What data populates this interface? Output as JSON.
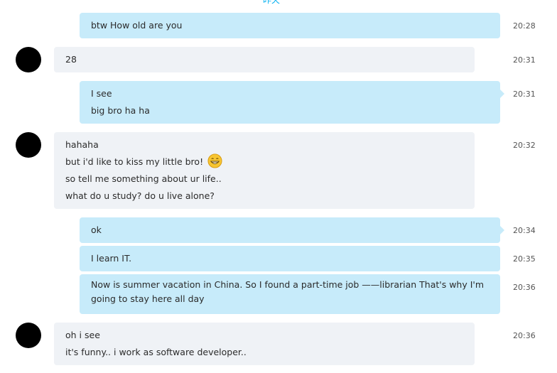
{
  "header_peek": "昨天",
  "messages": [
    {
      "text": "btw How old are you",
      "time": "20:28"
    },
    {
      "text": "28",
      "time": "20:31"
    },
    {
      "lines": [
        "I see",
        "big bro ha ha"
      ],
      "time": "20:31"
    },
    {
      "lines": [
        "hahaha",
        "but i'd like to kiss my little bro!",
        "so tell me something about ur life..",
        "what do u study? do u live alone?"
      ],
      "emoji": "grinning-emoji",
      "time": "20:32"
    },
    {
      "text": "ok",
      "time": "20:34"
    },
    {
      "text": "I learn IT.",
      "time": "20:35"
    },
    {
      "lines": [
        "Now is summer vacation in China. So I found a part-time job ——librarian That's why I'm",
        "going to stay here all day"
      ],
      "time": "20:36"
    },
    {
      "lines": [
        "oh i see",
        "it's funny.. i work as software developer.."
      ],
      "time": "20:36"
    }
  ],
  "colors": {
    "outgoing_bubble": "#c7ebfa",
    "incoming_bubble": "#eff2f6",
    "avatar": "#000000",
    "accent": "#00aff0"
  }
}
